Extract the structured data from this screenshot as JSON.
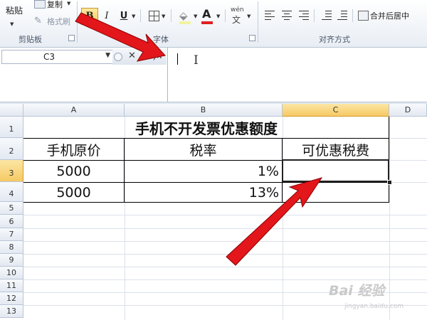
{
  "ribbon": {
    "clipboard": {
      "paste_label": "粘贴",
      "copy_label": "复制",
      "format_painter_label": "格式刷",
      "group_label": "剪贴板"
    },
    "font": {
      "bold_glyph": "B",
      "italic_glyph": "I",
      "underline_glyph": "U",
      "font_color_glyph": "A",
      "phonetic_glyph": "wén",
      "group_label": "字体",
      "accent_color": "#e02020"
    },
    "alignment": {
      "merge_center_label": "合并后居中",
      "group_label": "对齐方式"
    }
  },
  "formula_bar": {
    "name_box_value": "C3",
    "cancel_icon": "close-icon",
    "enter_icon": "check-icon",
    "function_label": "fx",
    "formula_value": ""
  },
  "sheet": {
    "columns": [
      "A",
      "B",
      "C",
      "D"
    ],
    "selected_column": "C",
    "rows": [
      "1",
      "2",
      "3",
      "4",
      "5",
      "6",
      "7",
      "8",
      "9",
      "10",
      "11",
      "12",
      "13"
    ],
    "selected_row": "3",
    "title": "手机不开发票优惠额度",
    "headers": [
      "手机原价",
      "税率",
      "可优惠税费"
    ],
    "data_rows": [
      {
        "price": "5000",
        "rate": "1%",
        "benefit": ""
      },
      {
        "price": "5000",
        "rate": "13%",
        "benefit": ""
      }
    ],
    "selection_color": "#f6c964"
  },
  "annotations": {
    "arrow_color": "#e3161b"
  },
  "watermark": {
    "logo": "Bai 经验",
    "site": "jingyan.baidu.com"
  }
}
